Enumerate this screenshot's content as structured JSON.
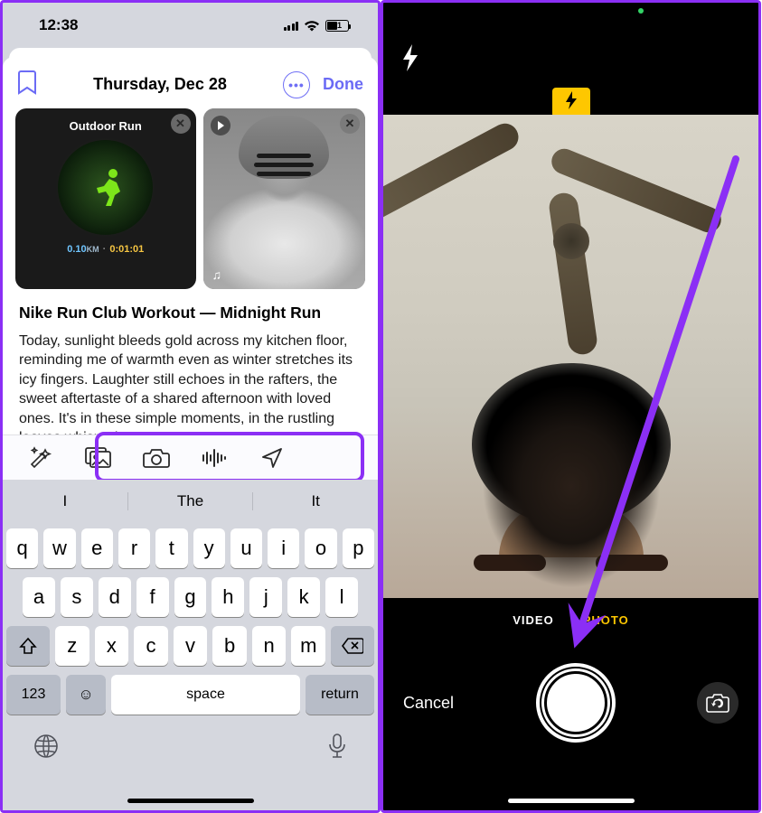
{
  "left": {
    "status": {
      "time": "12:38",
      "battery": "51"
    },
    "header": {
      "date": "Thursday, Dec 28",
      "done": "Done"
    },
    "workout": {
      "label": "Outdoor Run",
      "distance_val": "0.10",
      "distance_unit": "KM",
      "duration": "0:01:01"
    },
    "entry": {
      "title": "Nike Run Club Workout — Midnight Run",
      "body": "Today, sunlight bleeds gold across my kitchen floor, reminding me of warmth even as winter stretches its icy fingers. Laughter still echoes in the rafters, the sweet aftertaste of a shared afternoon with loved ones. It's in these simple moments, in the rustling leaves whispering"
    },
    "suggestions": {
      "a": "I",
      "b": "The",
      "c": "It"
    },
    "keys": {
      "r1": [
        "q",
        "w",
        "e",
        "r",
        "t",
        "y",
        "u",
        "i",
        "o",
        "p"
      ],
      "r2": [
        "a",
        "s",
        "d",
        "f",
        "g",
        "h",
        "j",
        "k",
        "l"
      ],
      "r3": [
        "z",
        "x",
        "c",
        "v",
        "b",
        "n",
        "m"
      ],
      "num": "123",
      "space": "space",
      "ret": "return"
    }
  },
  "right": {
    "modes": {
      "video": "VIDEO",
      "photo": "PHOTO"
    },
    "cancel": "Cancel"
  }
}
